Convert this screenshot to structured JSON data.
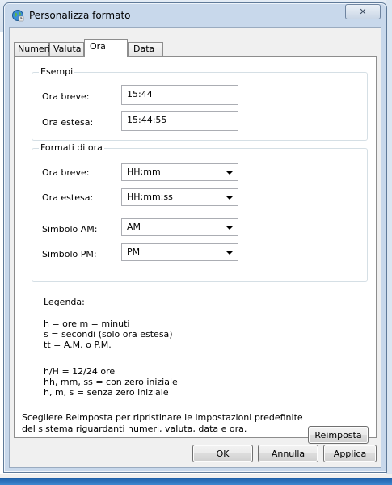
{
  "window": {
    "title": "Personalizza formato",
    "close_glyph": "✕"
  },
  "tabs": [
    {
      "label": "Numeri"
    },
    {
      "label": "Valuta"
    },
    {
      "label": "Ora"
    },
    {
      "label": "Data"
    }
  ],
  "active_tab": "Ora",
  "examples": {
    "title": "Esempi",
    "short_label": "Ora breve:",
    "short_value": "15:44",
    "long_label": "Ora estesa:",
    "long_value": "15:44:55"
  },
  "formats": {
    "title": "Formati di ora",
    "short_label": "Ora breve:",
    "short_value": "HH:mm",
    "long_label": "Ora estesa:",
    "long_value": "HH:mm:ss",
    "am_label": "Simbolo AM:",
    "am_value": "AM",
    "pm_label": "Simbolo PM:",
    "pm_value": "PM"
  },
  "legend": {
    "title": "Legenda:",
    "lines_a": [
      "h = ore   m = minuti",
      "s = secondi (solo ora estesa)",
      "tt = A.M. o P.M."
    ],
    "lines_b": [
      "h/H = 12/24 ore",
      "hh, mm, ss = con zero iniziale",
      "h, m, s = senza zero iniziale"
    ]
  },
  "reset": {
    "description_line1": "Scegliere Reimposta per ripristinare le impostazioni predefinite",
    "description_line2": "del sistema riguardanti numeri, valuta, data e ora.",
    "button_label": "Reimposta"
  },
  "footer": {
    "ok_label": "OK",
    "cancel_label": "Annulla",
    "apply_label": "Applica"
  }
}
